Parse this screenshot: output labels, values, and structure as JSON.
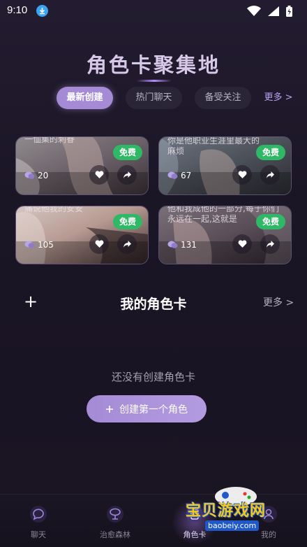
{
  "status": {
    "time": "9:10"
  },
  "header": {
    "title": "角色卡聚集地"
  },
  "tabs": [
    {
      "label": "最新创建"
    },
    {
      "label": "热门聊天"
    },
    {
      "label": "备受关注"
    },
    {
      "label": "更多 >"
    }
  ],
  "cards": [
    {
      "caption": "一恤集的刺眷",
      "badge": "免费",
      "count": "20"
    },
    {
      "caption": "你是他职业生涯里最大的麻烦",
      "badge": "免费",
      "count": "67"
    },
    {
      "caption": "痛说他我的安安",
      "badge": "免费",
      "count": "105"
    },
    {
      "caption": "他和我成他的一部分,每于你们永远在一起,这就是",
      "badge": "免费",
      "count": "131"
    }
  ],
  "mine": {
    "plus": "+",
    "title": "我的角色卡",
    "more": "更多 >"
  },
  "empty": {
    "text": "还没有创建角色卡",
    "button": "创建第一个角色"
  },
  "tabbar": [
    {
      "label": "聊天"
    },
    {
      "label": "治愈森林"
    },
    {
      "label": "角色卡"
    },
    {
      "label": "我的"
    }
  ],
  "watermark": {
    "text": "宝贝游戏网",
    "url": "baobeiy.com"
  },
  "colors": {
    "accent": "#a58bd6",
    "free_badge": "#2fb866",
    "background": "#1b1626"
  }
}
